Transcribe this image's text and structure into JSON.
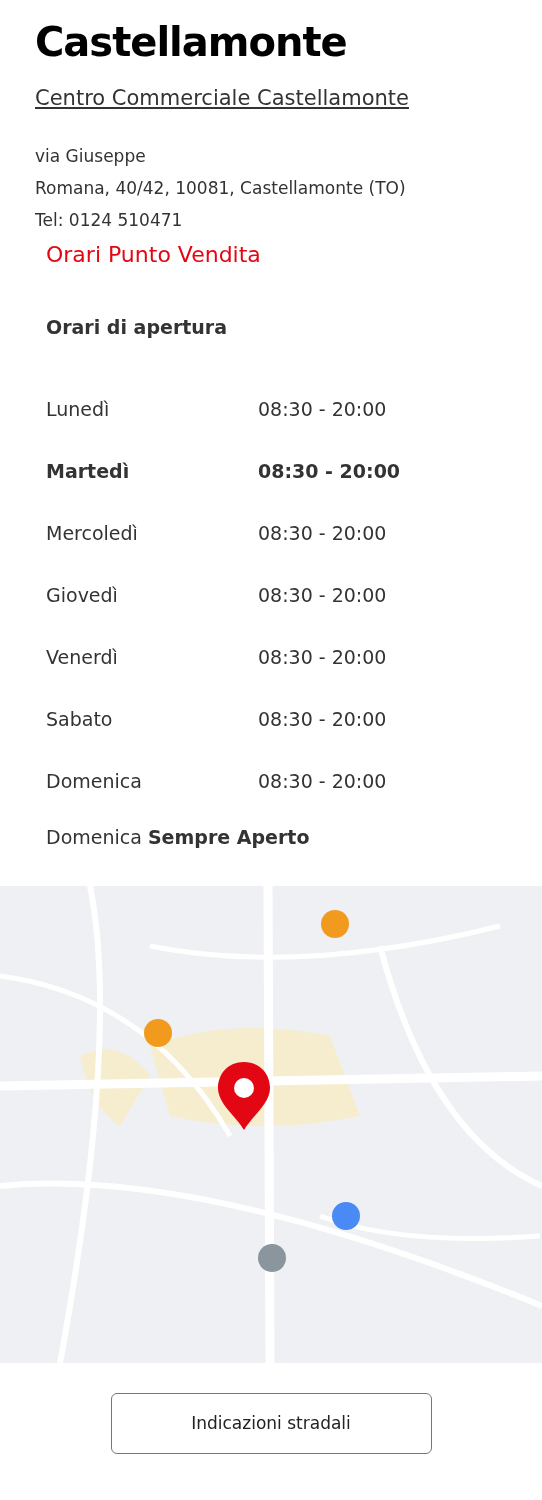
{
  "store": {
    "title": "Castellamonte",
    "name_link": "Centro Commerciale Castellamonte",
    "address_lines": [
      "via Giuseppe",
      "Romana, 40/42, 10081, Castellamonte (TO)",
      "Tel: 0124 510471"
    ]
  },
  "hours": {
    "heading": "Orari Punto Vendita",
    "subheading": "Orari di apertura",
    "rows": [
      {
        "day": "Lunedì",
        "time": "08:30 - 20:00",
        "selected": false
      },
      {
        "day": "Martedì",
        "time": "08:30 - 20:00",
        "selected": true
      },
      {
        "day": "Mercoledì",
        "time": "08:30 - 20:00",
        "selected": false
      },
      {
        "day": "Giovedì",
        "time": "08:30 - 20:00",
        "selected": false
      },
      {
        "day": "Venerdì",
        "time": "08:30 - 20:00",
        "selected": false
      },
      {
        "day": "Sabato",
        "time": "08:30 - 20:00",
        "selected": false
      },
      {
        "day": "Domenica",
        "time": "08:30 - 20:00",
        "selected": false
      }
    ],
    "note": "Domenica **Sempre Aperto**"
  },
  "directions_button": "Indicazioni stradali"
}
